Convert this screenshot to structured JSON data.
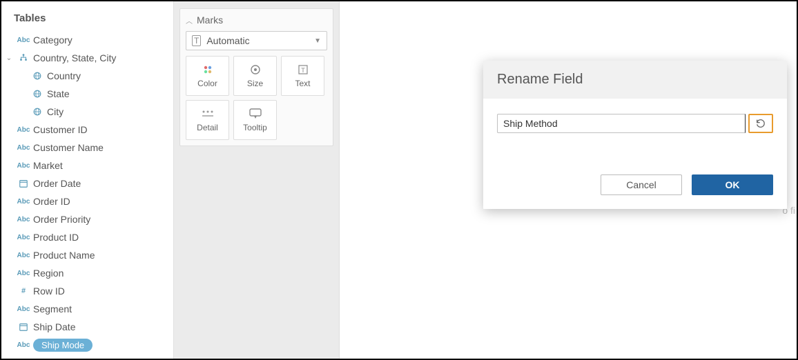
{
  "sidebar": {
    "title": "Tables",
    "fields": [
      {
        "type": "abc",
        "label": "Category"
      },
      {
        "type": "hierarchy",
        "label": "Country, State, City",
        "expanded": true
      },
      {
        "type": "globe",
        "label": "Country",
        "child": true
      },
      {
        "type": "globe",
        "label": "State",
        "child": true
      },
      {
        "type": "globe",
        "label": "City",
        "child": true
      },
      {
        "type": "abc",
        "label": "Customer ID"
      },
      {
        "type": "abc",
        "label": "Customer Name"
      },
      {
        "type": "abc",
        "label": "Market"
      },
      {
        "type": "date",
        "label": "Order Date"
      },
      {
        "type": "abc",
        "label": "Order ID"
      },
      {
        "type": "abc",
        "label": "Order Priority"
      },
      {
        "type": "abc",
        "label": "Product ID"
      },
      {
        "type": "abc",
        "label": "Product Name"
      },
      {
        "type": "abc",
        "label": "Region"
      },
      {
        "type": "num",
        "label": "Row ID"
      },
      {
        "type": "abc",
        "label": "Segment"
      },
      {
        "type": "date",
        "label": "Ship Date"
      },
      {
        "type": "abc",
        "label": "Ship Mode",
        "selected": true
      }
    ]
  },
  "marks": {
    "title": "Marks",
    "type_label": "Automatic",
    "shelves": {
      "color": "Color",
      "size": "Size",
      "text": "Text",
      "detail": "Detail",
      "tooltip": "Tooltip"
    }
  },
  "canvas": {
    "hint_fragment": "o fi"
  },
  "dialog": {
    "title": "Rename Field",
    "input_value": "Ship Method",
    "cancel": "Cancel",
    "ok": "OK"
  }
}
